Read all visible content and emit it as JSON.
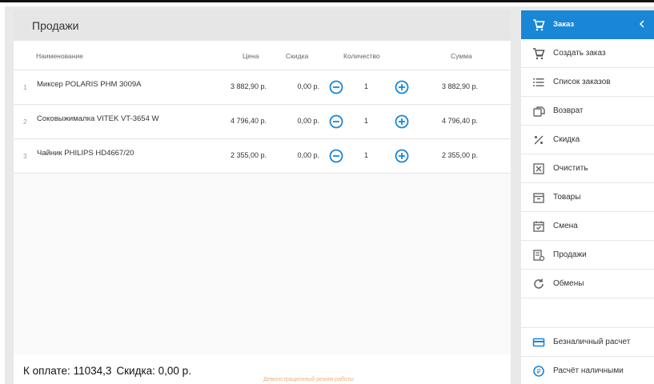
{
  "header": {
    "title": "Продажи"
  },
  "table": {
    "columns": {
      "name": "Наименование",
      "price": "Цена",
      "discount": "Скидка",
      "quantity": "Количество",
      "sum": "Сумма"
    },
    "rows": [
      {
        "num": "1",
        "name": "Миксер POLARIS PHM 3009A",
        "price": "3 882,90 р.",
        "discount": "0,00 р.",
        "qty": "1",
        "sum": "3 882,90 р."
      },
      {
        "num": "2",
        "name": "Соковыжималка VITEK VT-3654 W",
        "price": "4 796,40 р.",
        "discount": "0,00 р.",
        "qty": "1",
        "sum": "4 796,40 р."
      },
      {
        "num": "3",
        "name": "Чайник PHILIPS HD4667/20",
        "price": "2 355,00 р.",
        "discount": "0,00 р.",
        "qty": "1",
        "sum": "2 355,00 р."
      }
    ]
  },
  "footer": {
    "to_pay": "К оплате: 11034,3",
    "discount": "Скидка: 0,00 р.",
    "demo_mode": "Демонстрационный режим работы"
  },
  "sidebar": {
    "items": [
      {
        "label": "Заказ",
        "icon": "cart-icon",
        "active": true
      },
      {
        "label": "Создать заказ",
        "icon": "cart-icon"
      },
      {
        "label": "Список заказов",
        "icon": "list-icon"
      },
      {
        "label": "Возврат",
        "icon": "return-icon"
      },
      {
        "label": "Скидка",
        "icon": "percent-icon"
      },
      {
        "label": "Очистить",
        "icon": "clear-icon"
      },
      {
        "label": "Товары",
        "icon": "box-icon"
      },
      {
        "label": "Смена",
        "icon": "calendar-check-icon"
      },
      {
        "label": "Продажи",
        "icon": "receipt-icon"
      },
      {
        "label": "Обмены",
        "icon": "refresh-icon"
      },
      {
        "label": "Безналичный расчет",
        "icon": "credit-card-icon"
      },
      {
        "label": "Расчёт наличными",
        "icon": "cash-icon"
      }
    ]
  },
  "colors": {
    "accent": "#1a86d6",
    "icon_gray": "#666666",
    "header_bg": "#e6e6e6",
    "demo_text": "#f1b07a"
  }
}
